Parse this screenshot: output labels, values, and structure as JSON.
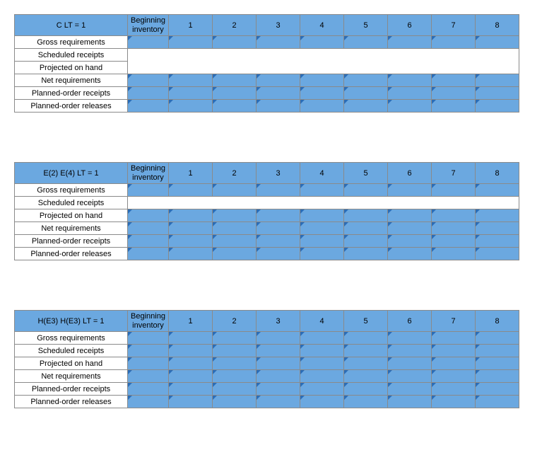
{
  "col_headers": {
    "beginning": "Beginning inventory",
    "periods": [
      "1",
      "2",
      "3",
      "4",
      "5",
      "6",
      "7",
      "8"
    ]
  },
  "row_labels": {
    "gross": "Gross requirements",
    "scheduled": "Scheduled receipts",
    "projected": "Projected on hand",
    "net": "Net requirements",
    "por": "Planned-order receipts",
    "porel": "Planned-order releases"
  },
  "tables": [
    {
      "title": "C LT = 1",
      "rows": [
        {
          "key": "gross",
          "filled": true,
          "merge_sched_proj": true
        },
        {
          "key": "scheduled",
          "filled": false
        },
        {
          "key": "projected",
          "filled": false
        },
        {
          "key": "net",
          "filled": true
        },
        {
          "key": "por",
          "filled": true
        },
        {
          "key": "porel",
          "filled": true
        }
      ]
    },
    {
      "title": "E(2) E(4) LT = 1",
      "rows": [
        {
          "key": "gross",
          "filled": true,
          "merge_sched_proj": false
        },
        {
          "key": "scheduled",
          "filled": false,
          "single_merge": true
        },
        {
          "key": "projected",
          "filled": true
        },
        {
          "key": "net",
          "filled": true
        },
        {
          "key": "por",
          "filled": true
        },
        {
          "key": "porel",
          "filled": true
        }
      ]
    },
    {
      "title": "H(E3) H(E3) LT = 1",
      "rows": [
        {
          "key": "gross",
          "filled": true,
          "merge_sched_proj": false
        },
        {
          "key": "scheduled",
          "filled": true
        },
        {
          "key": "projected",
          "filled": true
        },
        {
          "key": "net",
          "filled": true
        },
        {
          "key": "por",
          "filled": true
        },
        {
          "key": "porel",
          "filled": true
        }
      ]
    }
  ]
}
